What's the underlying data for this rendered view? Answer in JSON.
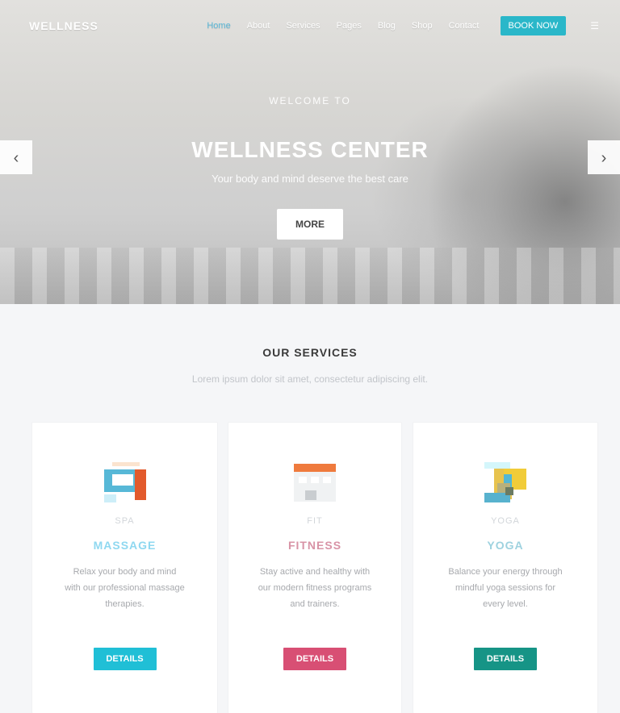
{
  "header": {
    "logo": "WELLNESS",
    "nav": [
      "Home",
      "About",
      "Services",
      "Pages",
      "Blog",
      "Shop",
      "Contact"
    ],
    "active_index": 0,
    "cta": "BOOK NOW",
    "extra": "☰"
  },
  "hero": {
    "eyebrow": "WELCOME TO",
    "title": "WELLNESS CENTER",
    "subtitle": "Your body and mind deserve the best care",
    "button": "MORE",
    "left_arrow": "‹",
    "right_arrow": "›"
  },
  "section": {
    "title": "OUR SERVICES",
    "subtitle": "Lorem ipsum dolor sit amet, consectetur adipiscing elit."
  },
  "cards": [
    {
      "kicker": "SPA",
      "title": "MASSAGE",
      "title_color": "#8fd8f0",
      "text": "Relax your body and mind with our professional massage therapies.",
      "button": "DETAILS",
      "button_color": "#20bfd6",
      "icon_name": "screen-icon"
    },
    {
      "kicker": "FIT",
      "title": "FITNESS",
      "title_color": "#d893a6",
      "text": "Stay active and healthy with our modern fitness programs and trainers.",
      "button": "DETAILS",
      "button_color": "#d84f74",
      "icon_name": "calendar-icon"
    },
    {
      "kicker": "YOGA",
      "title": "YOGA",
      "title_color": "#9ed2df",
      "text": "Balance your energy through mindful yoga sessions for every level.",
      "button": "DETAILS",
      "button_color": "#169486",
      "icon_name": "puzzle-icon"
    }
  ]
}
